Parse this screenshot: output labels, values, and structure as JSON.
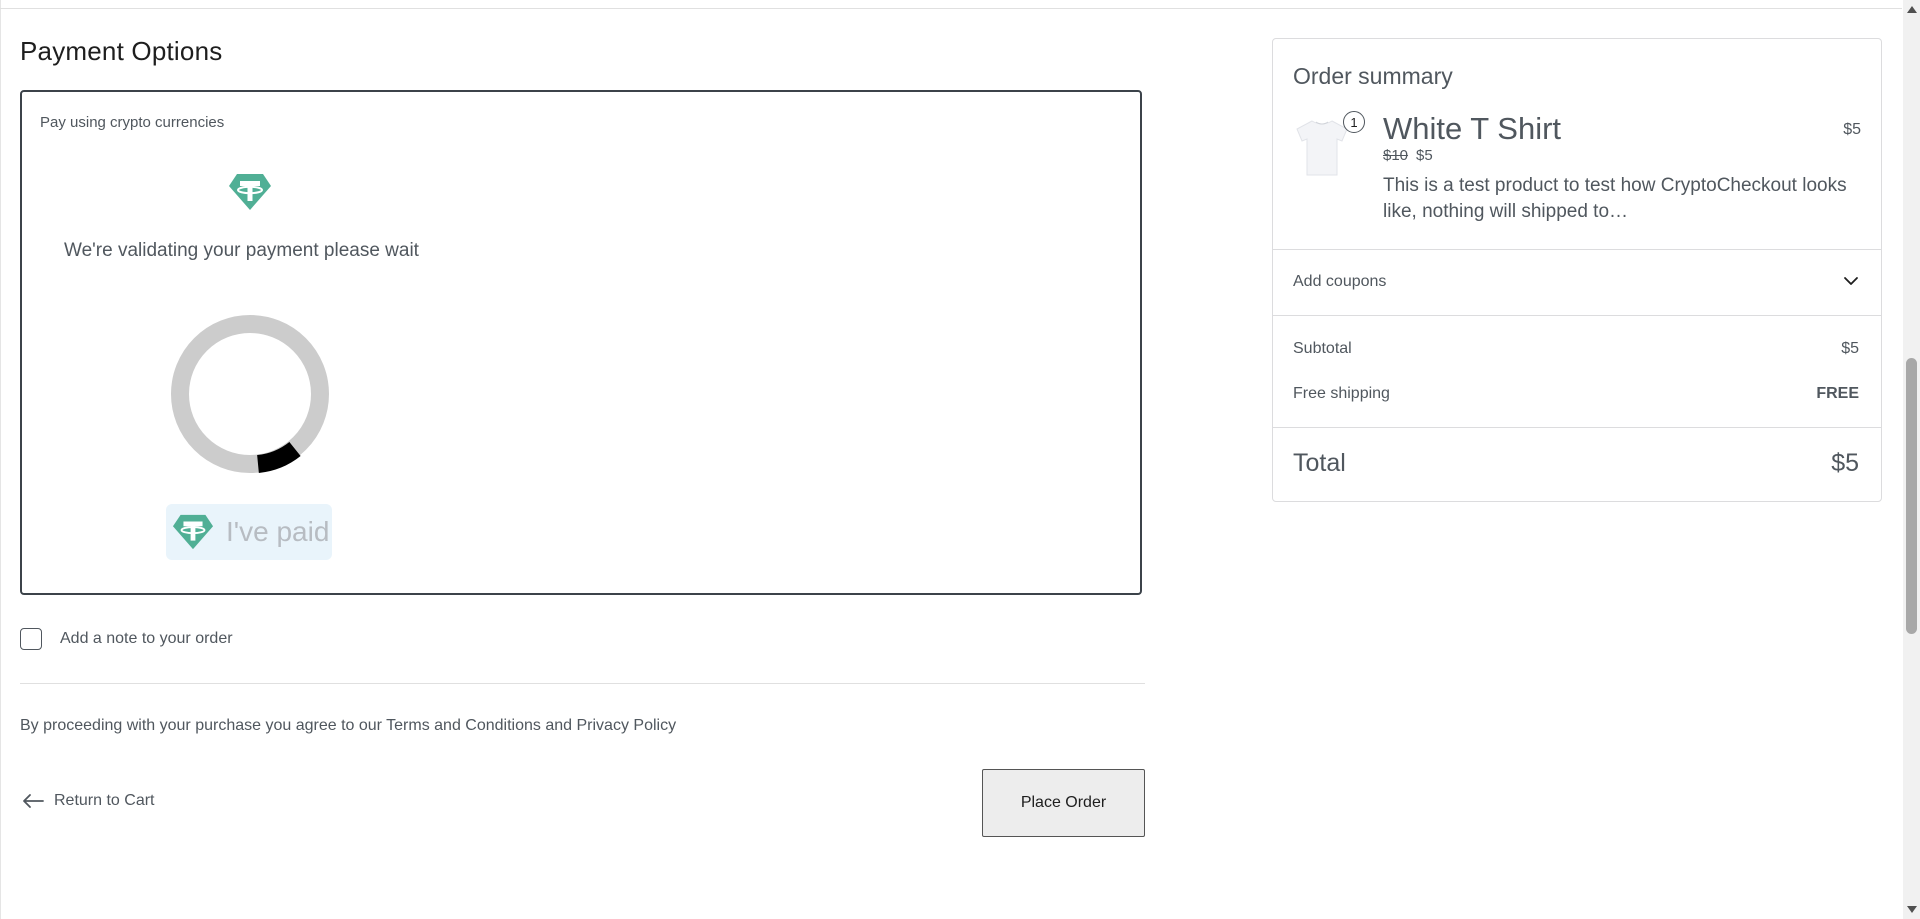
{
  "payment": {
    "title": "Payment Options",
    "method_label": "Pay using crypto currencies",
    "status_text": "We're validating your payment please wait",
    "paid_button_label": "I've paid"
  },
  "note": {
    "label": "Add a note to your order"
  },
  "terms": {
    "prefix": "By proceeding with your purchase you agree to our ",
    "terms_link": "Terms and Conditions",
    "middle": " and ",
    "privacy_link": "Privacy Policy"
  },
  "actions": {
    "return_label": "Return to Cart",
    "place_order_label": "Place Order"
  },
  "summary": {
    "title": "Order summary",
    "product": {
      "name": "White T Shirt",
      "quantity": "1",
      "line_price": "$5",
      "original_price": "$10",
      "sale_price": "$5",
      "description": "This is a test product to test how CryptoCheckout looks like, nothing will shipped to…"
    },
    "coupons_label": "Add coupons",
    "subtotal_label": "Subtotal",
    "subtotal_value": "$5",
    "shipping_label": "Free shipping",
    "shipping_value": "FREE",
    "total_label": "Total",
    "total_value": "$5"
  },
  "icons": {
    "crypto": "tether-logo-icon",
    "back": "arrow-left-icon",
    "expand": "chevron-down-icon",
    "loading": "loading-spinner"
  },
  "colors": {
    "tether": "#50af95",
    "paid_button_bg": "#e9f4fb",
    "spinner_track": "#cccccc",
    "spinner_active": "#000000"
  }
}
